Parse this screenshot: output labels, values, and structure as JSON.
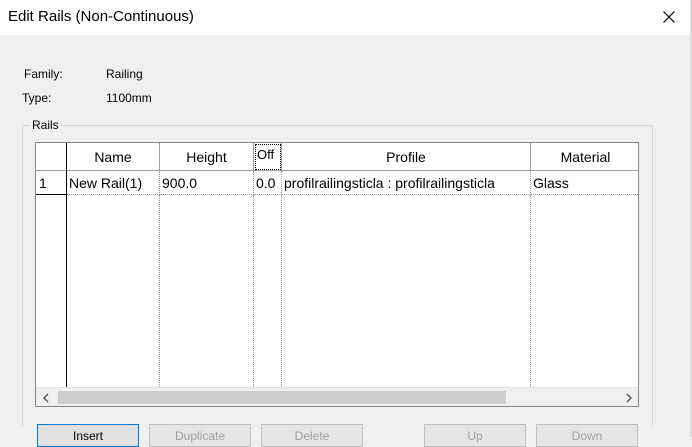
{
  "window": {
    "title": "Edit Rails (Non-Continuous)"
  },
  "icons": {
    "close": "close-icon",
    "scroll_left": "chevron-left-icon",
    "scroll_right": "chevron-right-icon"
  },
  "properties": {
    "family_label": "Family:",
    "family_value": "Railing",
    "type_label": "Type:",
    "type_value": "1100mm"
  },
  "rails": {
    "group_label": "Rails",
    "columns": [
      "Name",
      "Height",
      "Off",
      "Profile",
      "Material"
    ],
    "rows": [
      {
        "num": "1",
        "name": "New Rail(1)",
        "height": "900.0",
        "offset": "0.0",
        "profile": "profilrailingsticla : profilrailingsticla",
        "material": "Glass"
      }
    ]
  },
  "buttons": {
    "insert": "Insert",
    "duplicate": "Duplicate",
    "delete": "Delete",
    "up": "Up",
    "down": "Down"
  }
}
